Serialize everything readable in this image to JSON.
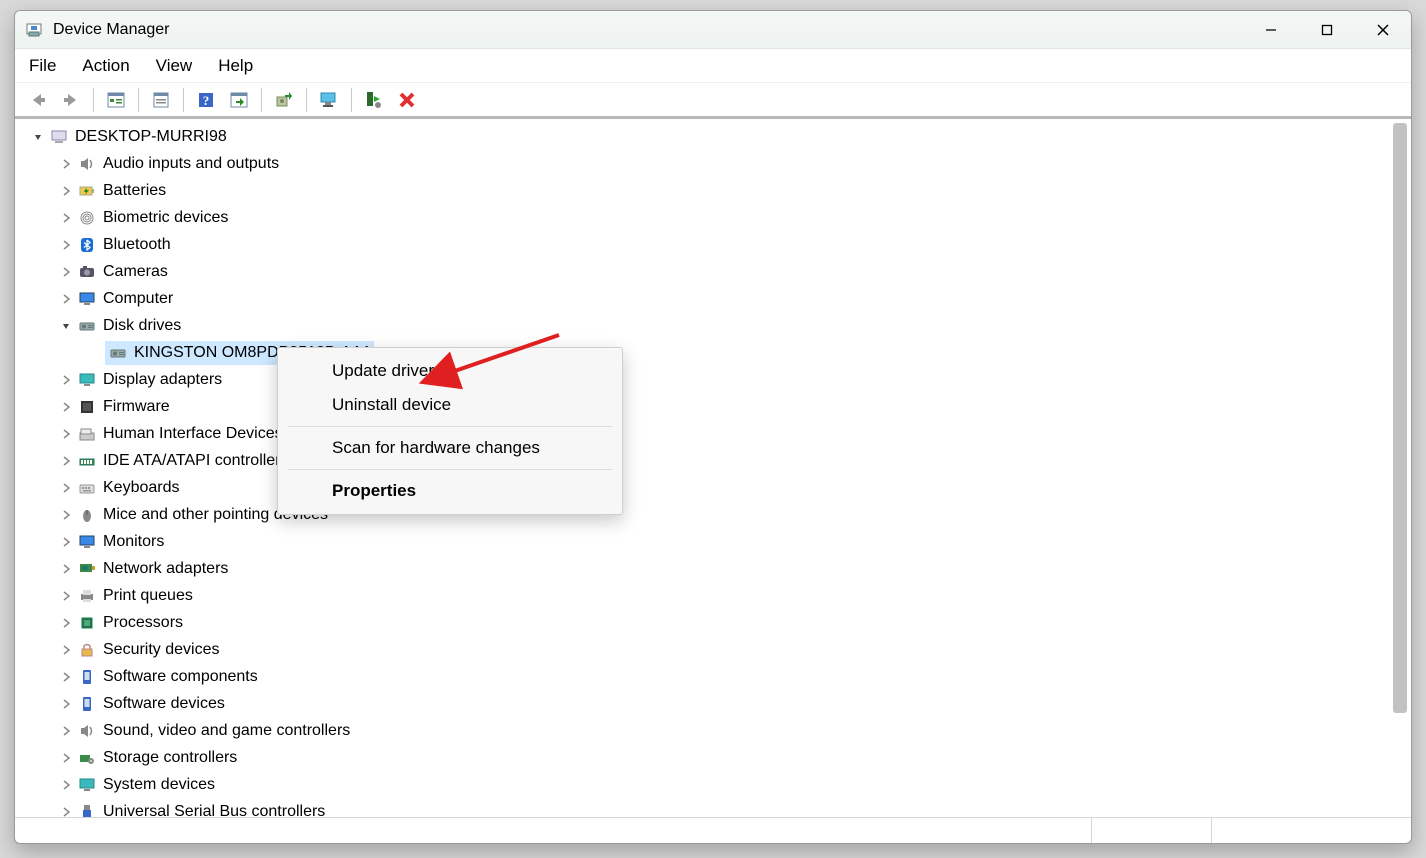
{
  "window": {
    "title": "Device Manager"
  },
  "menu": {
    "file": "File",
    "action": "Action",
    "view": "View",
    "help": "Help"
  },
  "root": {
    "name": "DESKTOP-MURRI98"
  },
  "categories": [
    {
      "label": "Audio inputs and outputs",
      "expanded": false,
      "icon": "speaker"
    },
    {
      "label": "Batteries",
      "expanded": false,
      "icon": "battery"
    },
    {
      "label": "Biometric devices",
      "expanded": false,
      "icon": "fingerprint"
    },
    {
      "label": "Bluetooth",
      "expanded": false,
      "icon": "bluetooth"
    },
    {
      "label": "Cameras",
      "expanded": false,
      "icon": "camera"
    },
    {
      "label": "Computer",
      "expanded": false,
      "icon": "monitor-blue"
    },
    {
      "label": "Disk drives",
      "expanded": true,
      "icon": "hdd",
      "children": [
        {
          "label": "KINGSTON OM8PDP3512B-AA1",
          "icon": "hdd-small",
          "selected": true
        }
      ]
    },
    {
      "label": "Display adapters",
      "expanded": false,
      "icon": "monitor-teal"
    },
    {
      "label": "Firmware",
      "expanded": false,
      "icon": "chip-dark"
    },
    {
      "label": "Human Interface Devices",
      "expanded": false,
      "icon": "hid"
    },
    {
      "label": "IDE ATA/ATAPI controllers",
      "expanded": false,
      "icon": "ide"
    },
    {
      "label": "Keyboards",
      "expanded": false,
      "icon": "keyboard"
    },
    {
      "label": "Mice and other pointing devices",
      "expanded": false,
      "icon": "mouse"
    },
    {
      "label": "Monitors",
      "expanded": false,
      "icon": "monitor-blue"
    },
    {
      "label": "Network adapters",
      "expanded": false,
      "icon": "nic"
    },
    {
      "label": "Print queues",
      "expanded": false,
      "icon": "printer"
    },
    {
      "label": "Processors",
      "expanded": false,
      "icon": "cpu"
    },
    {
      "label": "Security devices",
      "expanded": false,
      "icon": "lock"
    },
    {
      "label": "Software components",
      "expanded": false,
      "icon": "sw-comp"
    },
    {
      "label": "Software devices",
      "expanded": false,
      "icon": "sw-dev"
    },
    {
      "label": "Sound, video and game controllers",
      "expanded": false,
      "icon": "speaker"
    },
    {
      "label": "Storage controllers",
      "expanded": false,
      "icon": "storage-ctrl"
    },
    {
      "label": "System devices",
      "expanded": false,
      "icon": "monitor-teal"
    },
    {
      "label": "Universal Serial Bus controllers",
      "expanded": false,
      "icon": "usb"
    }
  ],
  "context_menu": {
    "update_driver": "Update driver",
    "uninstall_device": "Uninstall device",
    "scan_hardware": "Scan for hardware changes",
    "properties": "Properties"
  },
  "icons": {
    "speaker": "🔈",
    "battery": "🔋",
    "fingerprint": "👆",
    "bluetooth": "bt",
    "camera": "📷",
    "monitor-blue": "🖥",
    "hdd": "💽",
    "hdd-small": "💽",
    "monitor-teal": "🖥",
    "chip-dark": "▦",
    "hid": "⌨",
    "ide": "▤",
    "keyboard": "⌨",
    "mouse": "🖱",
    "nic": "🖧",
    "printer": "🖨",
    "cpu": "▣",
    "lock": "🔒",
    "sw-comp": "📱",
    "sw-dev": "📱",
    "storage-ctrl": "⚙",
    "usb": "🔌",
    "computer-root": "🖥"
  }
}
